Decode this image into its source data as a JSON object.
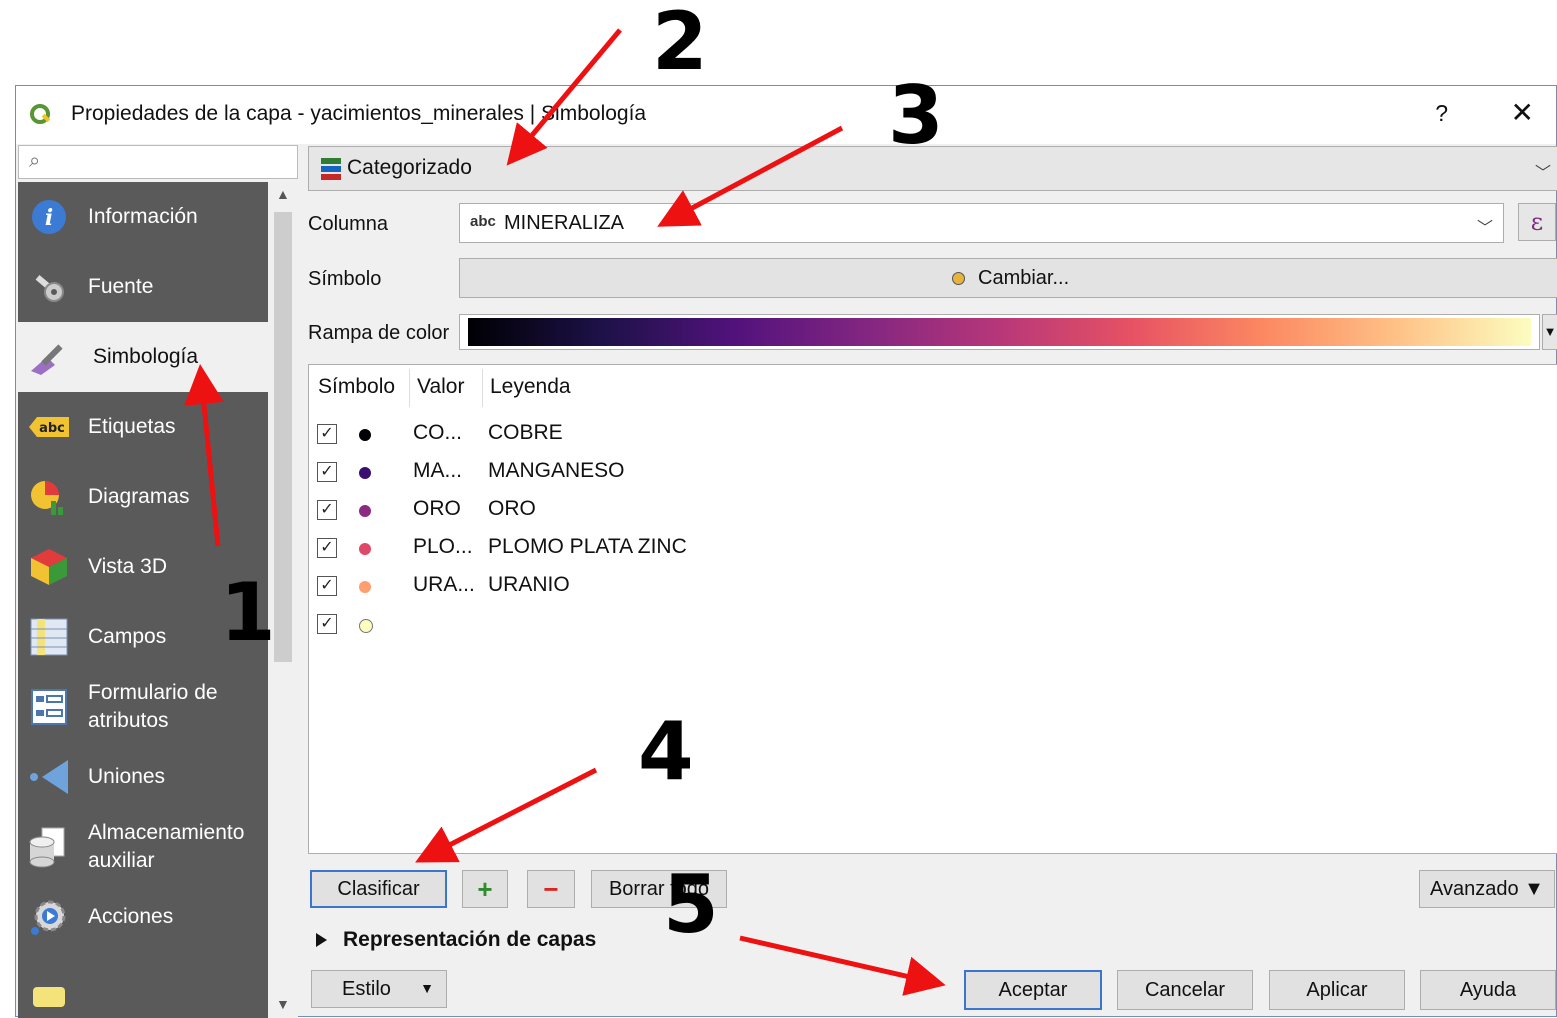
{
  "window": {
    "title": "Propiedades de la capa - yacimientos_minerales | Simbología",
    "help_label": "?",
    "close_label": "✕"
  },
  "search": {
    "placeholder": ""
  },
  "sidebar": {
    "items": [
      {
        "label": "Información",
        "icon": "info-icon"
      },
      {
        "label": "Fuente",
        "icon": "tools-icon"
      },
      {
        "label": "Simbología",
        "icon": "paintbrush-icon"
      },
      {
        "label": "Etiquetas",
        "icon": "abc-label-icon"
      },
      {
        "label": "Diagramas",
        "icon": "diagram-icon"
      },
      {
        "label": "Vista 3D",
        "icon": "cube-icon"
      },
      {
        "label": "Campos",
        "icon": "fields-icon"
      },
      {
        "label": "Formulario de atributos",
        "icon": "form-icon"
      },
      {
        "label": "Uniones",
        "icon": "join-icon"
      },
      {
        "label": "Almacenamiento auxiliar",
        "icon": "storage-icon"
      },
      {
        "label": "Acciones",
        "icon": "actions-icon"
      }
    ],
    "active": "Simbología"
  },
  "renderer": {
    "type_label": "Categorizado"
  },
  "column": {
    "label": "Columna",
    "type_badge": "abc",
    "value": "MINERALIZA",
    "expression_label": "ε"
  },
  "symbol": {
    "label": "Símbolo",
    "button_label": "Cambiar..."
  },
  "ramp": {
    "label": "Rampa de color"
  },
  "table": {
    "headers": [
      "Símbolo",
      "Valor",
      "Leyenda"
    ],
    "rows": [
      {
        "value": "CO...",
        "legend": "COBRE",
        "color": "#000004"
      },
      {
        "value": "MA...",
        "legend": "MANGANESO",
        "color": "#3b0f70"
      },
      {
        "value": "ORO",
        "legend": "ORO",
        "color": "#8c2981"
      },
      {
        "value": "PLO...",
        "legend": "PLOMO PLATA ZINC",
        "color": "#de4968"
      },
      {
        "value": "URA...",
        "legend": "URANIO",
        "color": "#fe9f6d"
      },
      {
        "value": "",
        "legend": "",
        "color": "#fcfdbf"
      }
    ]
  },
  "buttons": {
    "classify": "Clasificar",
    "add": "+",
    "remove": "−",
    "delete_all": "Borrar todo",
    "advanced": "Avanzado ▼",
    "style": "Estilo",
    "accept": "Aceptar",
    "cancel": "Cancelar",
    "apply": "Aplicar",
    "help": "Ayuda"
  },
  "layer_rendering": {
    "label": "Representación de capas"
  },
  "annotations": [
    "1",
    "2",
    "3",
    "4",
    "5"
  ],
  "colors": {
    "arrow": "#ee1111",
    "sidebar_bg": "#5a5a5a",
    "focus": "#3a76d0"
  }
}
